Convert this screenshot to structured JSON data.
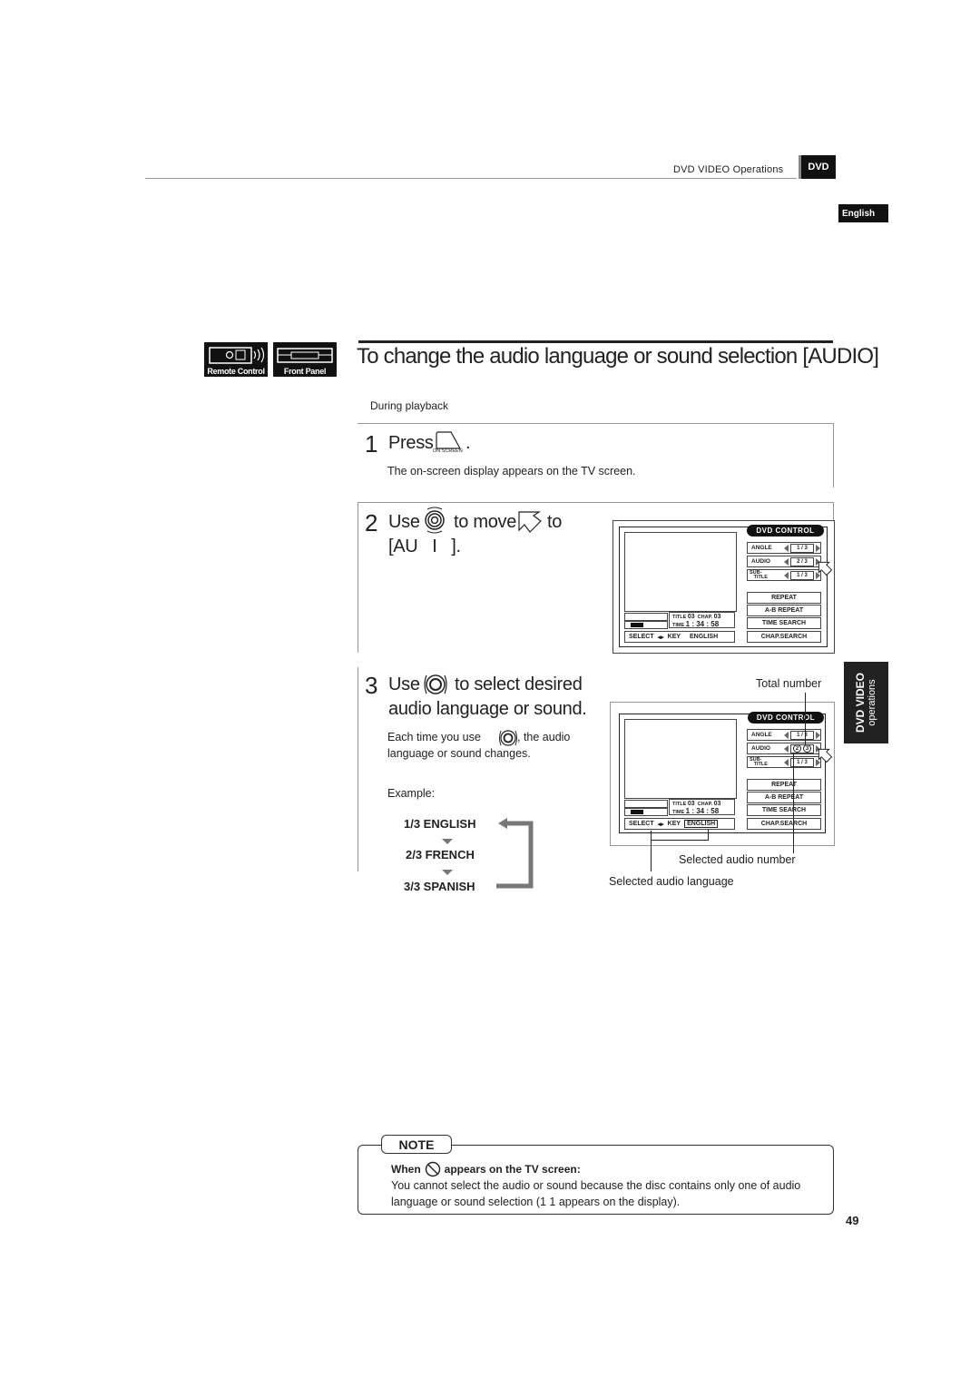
{
  "header": {
    "section": "DVD VIDEO Operations",
    "badge": "DVD",
    "language_tab": "English"
  },
  "modes": [
    {
      "label": "Remote Control",
      "icon": "remote-control-icon"
    },
    {
      "label": "Front Panel",
      "icon": "front-panel-icon"
    }
  ],
  "page_title": "To change the audio language or sound selection [AUDIO]",
  "context": "During playback",
  "steps": [
    {
      "number": "1",
      "heading_pre": "Press",
      "button_label": "ON SCREEN",
      "heading_post": ".",
      "description": "The on-screen display appears on the TV screen."
    },
    {
      "number": "2",
      "heading_pre": "Use",
      "heading_mid": "to move",
      "heading_post": "to",
      "heading_line2": "[AU   I   ]."
    },
    {
      "number": "3",
      "heading_pre": "Use",
      "heading_post": "to select desired",
      "heading_line2": "audio language or sound.",
      "desc_pre": "Each time you use",
      "desc_post": ", the audio",
      "desc_line2": "language or sound changes.",
      "example_label": "Example:",
      "examples": [
        "1/3 ENGLISH",
        "2/3 FRENCH",
        "3/3 SPANISH"
      ]
    }
  ],
  "osd": {
    "title": "DVD CONTROL",
    "rows": [
      {
        "label": "ANGLE",
        "value": "1 / 3"
      },
      {
        "label": "AUDIO",
        "value": "2 / 3"
      },
      {
        "label_top": "SUB-",
        "label_bottom": "TITLE",
        "value": "1 / 3"
      }
    ],
    "buttons": [
      "REPEAT",
      "A-B REPEAT",
      "TIME SEARCH",
      "CHAP.SEARCH"
    ],
    "title_label": "TITLE",
    "title_value": "03",
    "chap_label": "CHAP.",
    "chap_value": "03",
    "time_label": "TIME",
    "time_value": "1 : 34 : 58",
    "select_label": "SELECT",
    "key_label": "KEY",
    "language": "ENGLISH",
    "audio_current": "2",
    "audio_total": "3"
  },
  "callouts": {
    "total_number": "Total number",
    "selected_audio_number": "Selected audio number",
    "selected_audio_language": "Selected audio language"
  },
  "side_tab": {
    "line1": "DVD VIDEO",
    "line2": "operations"
  },
  "note": {
    "tab": "NOTE",
    "heading_pre": "When",
    "heading_post": "appears on the TV screen:",
    "body": "You cannot select the audio or sound because the disc contains only one of audio language or sound selection (1 1 appears on the display)."
  },
  "page_number": "49"
}
